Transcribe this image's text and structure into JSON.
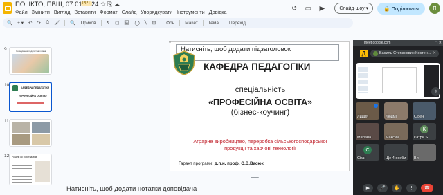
{
  "doc": {
    "title": "ПО, ІКТО, ПВШ, 07.01.2024",
    "badge": "PPT",
    "menu": [
      "Файл",
      "Змінити",
      "Вигляд",
      "Вставити",
      "Формат",
      "Слайд",
      "Упорядкувати",
      "Інструменти",
      "Довідка"
    ],
    "slideshow_label": "Слайд-шоу",
    "share_label": "Поділитися",
    "avatar_letter": "П"
  },
  "toolbar": {
    "layout_label": "Прихов",
    "items": [
      "Фон",
      "Макет",
      "Тема",
      "Перехід"
    ]
  },
  "filmstrip": {
    "numbers": [
      "9",
      "10",
      "11",
      "12"
    ],
    "thumb_title_9": "Формування педагогічних вмінь",
    "thumb_title_10": "КАФЕДРА ПЕДАГОГІКИ",
    "thumb_spec_10": "«ПРОФЕСІЙНА ОСВІТА»",
    "thumb_title_12": "Розділи ЦІ: роботодавців"
  },
  "slide": {
    "subtitle_placeholder": "Натисніть, щоб додати підзаголовок",
    "department": "КАФЕДРА ПЕДАГОГІКИ",
    "spec_line1": "спеціальність",
    "spec_line2": "«ПРОФЕСІЙНА ОСВІТА»",
    "spec_line3": "(бізнес-коучинг)",
    "agro_line1": "Аграрне виробництво, переробка сільськогосподарської",
    "agro_line2": "продукції та харчові технології",
    "guarantor_label": "Гарант програми:",
    "guarantor_name": "д.п.н, проф. О.В.Васюк"
  },
  "notes": {
    "placeholder": "Натисніть, щоб додати нотатки доповідача"
  },
  "meet": {
    "url": "meet.google.com",
    "presenter_badge": "Д",
    "presenter_name": "Василь Степанович Костен...",
    "participants": [
      {
        "name": "Лидия",
        "color": "#6b5a48"
      },
      {
        "name": "Людмі",
        "color": "#8c7a6a"
      },
      {
        "name": "Сірен",
        "color": "#4a5a6a"
      },
      {
        "name": "Милана",
        "color": "#5a4a46"
      },
      {
        "name": "Максим",
        "color": "#7a6a5a"
      },
      {
        "name": "Катри S",
        "color": "#3c4043",
        "letter": "K",
        "avatar": "#5e8c5a"
      },
      {
        "name": "Сіми",
        "color": "#3c4043",
        "letter": "C",
        "avatar": "#2e7d52"
      },
      {
        "name": "Ще 4 особи",
        "color": "#3c4043"
      },
      {
        "name": "Ви",
        "color": "#6a6a6a"
      }
    ],
    "colors": {
      "panel": "#202124",
      "end_call": "#ea4335",
      "accent": "#1a73e8"
    }
  }
}
